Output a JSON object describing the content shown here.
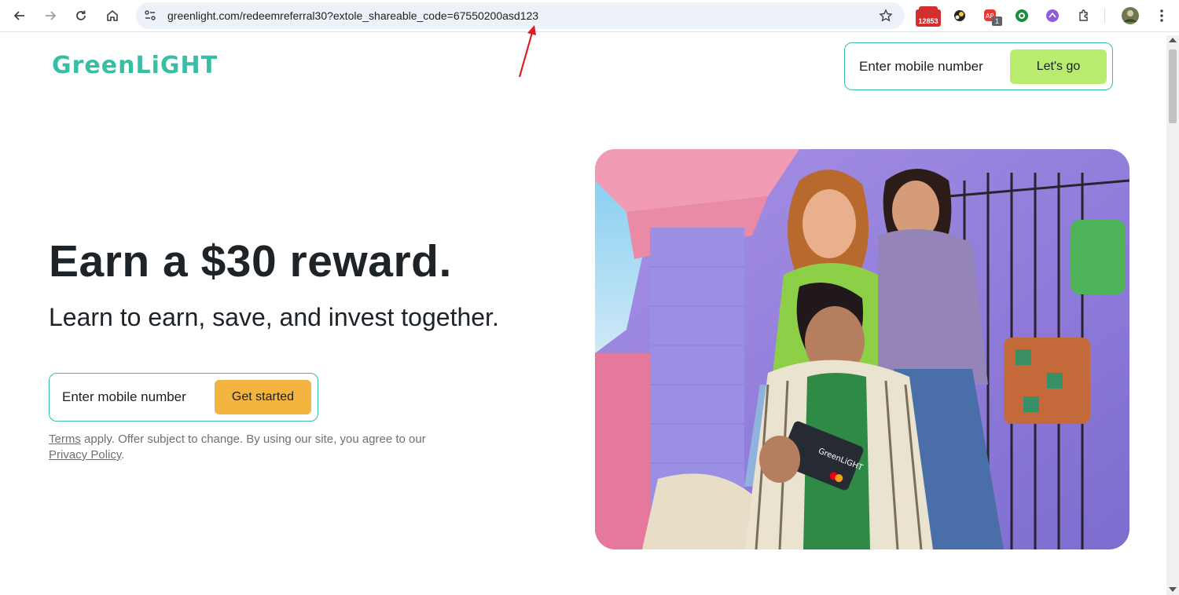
{
  "browser": {
    "url": "greenlight.com/redeemreferral30?extole_shareable_code=67550200asd123",
    "extension_badge_count": "12853",
    "small_badge": "1"
  },
  "header": {
    "logo_text": "GreenLiGHT",
    "mobile_placeholder": "Enter mobile number",
    "cta_label": "Let's go"
  },
  "hero": {
    "headline": "Earn a $30 reward.",
    "subhead": "Learn to earn, save, and invest together.",
    "mobile_placeholder": "Enter mobile number",
    "cta_label": "Get started",
    "legal_terms_link": "Terms",
    "legal_text_1": " apply. Offer subject to change. By using our site, you agree to our ",
    "legal_privacy_link": "Privacy Policy",
    "legal_text_2": ".",
    "card_text": "GreenLiGHT"
  },
  "colors": {
    "brand_teal": "#36bfa5",
    "lime_button": "#b8ec6e",
    "amber_button": "#f3b53f"
  },
  "icons": [
    "back-icon",
    "forward-icon",
    "reload-icon",
    "home-icon",
    "site-info-icon",
    "star-icon",
    "extensions-icon",
    "menu-icon"
  ]
}
